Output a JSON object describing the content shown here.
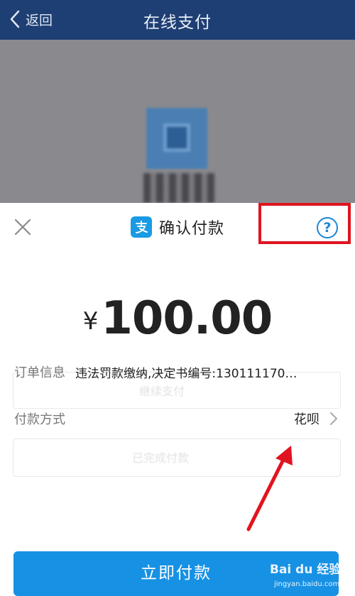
{
  "nav": {
    "back_label": "返回",
    "title": "在线支付"
  },
  "sheet": {
    "title": "确认付款",
    "help_symbol": "?",
    "currency_symbol": "¥",
    "amount": "100.00",
    "order_label": "订单信息",
    "order_value": "违法罚款缴纳,决定书编号:130111170…",
    "payment_label": "付款方式",
    "payment_value": "花呗",
    "confirm_label": "立即付款"
  },
  "background_page": {
    "button_continue": "继续支付",
    "button_done": "已完成付款"
  },
  "watermark": {
    "brand": "Bai du 经验",
    "url": "jingyan.baidu.com"
  },
  "colors": {
    "nav_bar": "#1e3f73",
    "accent_blue": "#1791e4",
    "alipay_blue": "#1a9ae4",
    "highlight_red": "#e0141f",
    "overlay_gray": "#8a8a8e"
  },
  "icons": [
    "chevron-left-icon",
    "close-icon",
    "alipay-logo-icon",
    "help-icon",
    "chevron-right-icon",
    "red-arrow-annotation-icon"
  ]
}
